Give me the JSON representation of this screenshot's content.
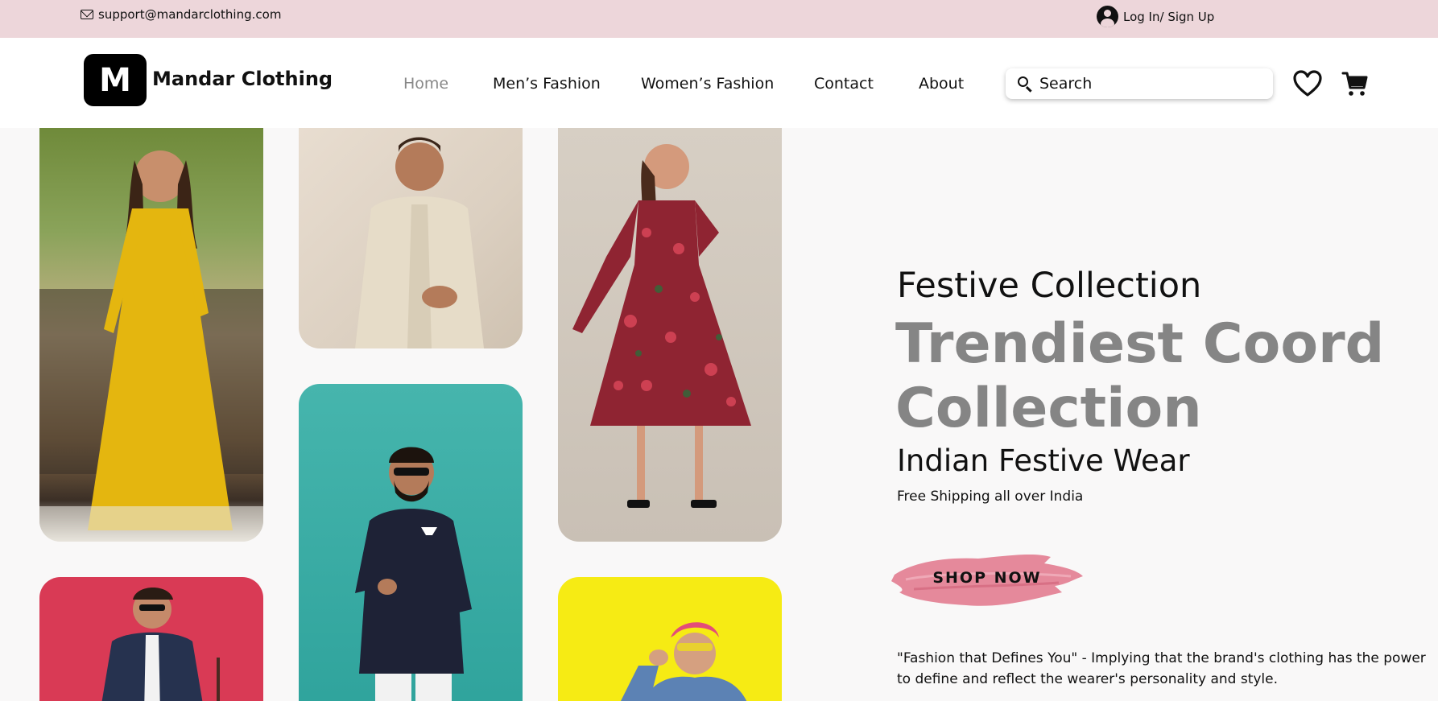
{
  "topbar": {
    "email": "support@mandarclothing.com",
    "login": "Log In/ Sign Up"
  },
  "header": {
    "logo_letter": "M",
    "brand": "Mandar Clothing",
    "nav": [
      {
        "label": "Home",
        "active": true
      },
      {
        "label": "Men’s Fashion",
        "active": false
      },
      {
        "label": "Women’s Fashion",
        "active": false
      },
      {
        "label": "Contact",
        "active": false
      },
      {
        "label": "About",
        "active": false
      }
    ],
    "search_placeholder": "Search",
    "icons": [
      "heart-icon",
      "cart-icon",
      "search-icon",
      "user-icon",
      "mail-icon"
    ]
  },
  "hero": {
    "kicker": "Festive Collection",
    "headline": "Trendiest Coord Collection",
    "subhead": "Indian Festive Wear",
    "note": "Free Shipping all over India",
    "cta": "SHOP NOW",
    "quote": "\"Fashion that Defines You\" - Implying that the brand's clothing has the power to define and reflect the wearer's personality and style."
  },
  "colors": {
    "topbar_bg": "#edd6da",
    "accent_pink": "#e27c90",
    "headline_gray": "#858585"
  }
}
